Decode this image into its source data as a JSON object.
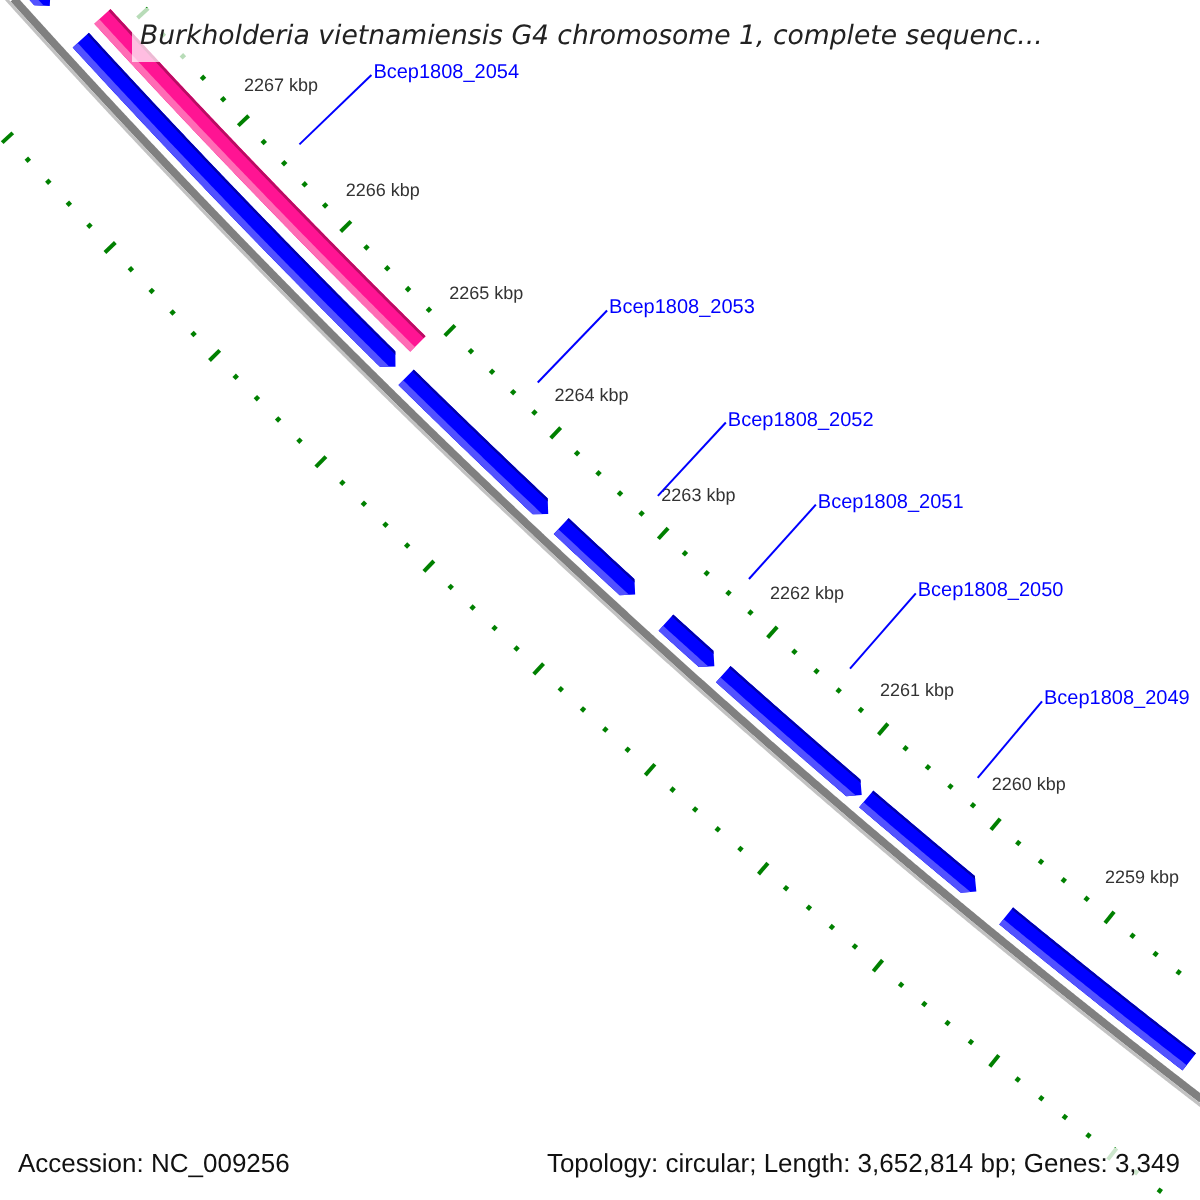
{
  "title": "Burkholderia vietnamiensis G4 chromosome 1, complete sequenc...",
  "ruler": [
    {
      "label": "2267 kbp"
    },
    {
      "label": "2266 kbp"
    },
    {
      "label": "2265 kbp"
    },
    {
      "label": "2264 kbp"
    },
    {
      "label": "2263 kbp"
    },
    {
      "label": "2262 kbp"
    },
    {
      "label": "2261 kbp"
    },
    {
      "label": "2260 kbp"
    },
    {
      "label": "2259 kbp"
    }
  ],
  "genes": [
    {
      "label": "Bcep1808_2054"
    },
    {
      "label": "Bcep1808_2053"
    },
    {
      "label": "Bcep1808_2052"
    },
    {
      "label": "Bcep1808_2051"
    },
    {
      "label": "Bcep1808_2050"
    },
    {
      "label": "Bcep1808_2049"
    }
  ],
  "footer": {
    "accession": "Accession: NC_009256",
    "summary": "Topology: circular; Length: 3,652,814 bp; Genes: 3,349"
  }
}
